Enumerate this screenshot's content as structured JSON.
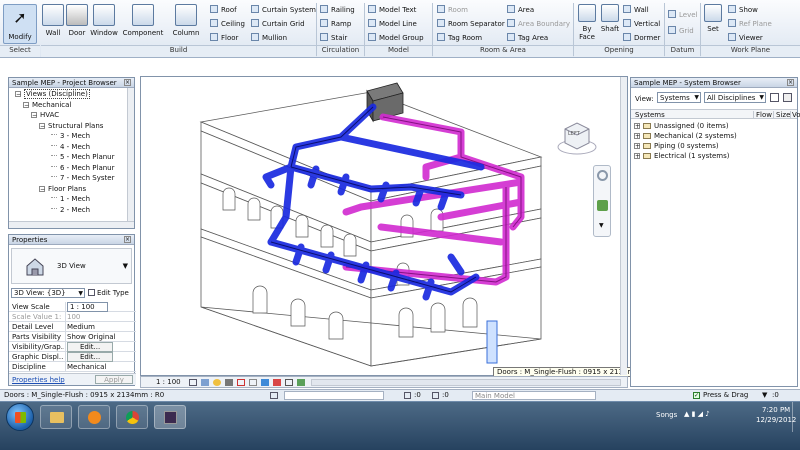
{
  "ribbon": {
    "modify_label": "Modify",
    "wall_label": "Wall",
    "door_label": "Door",
    "window_label": "Window",
    "component_label": "Component",
    "column_label": "Column",
    "roof_label": "Roof",
    "ceiling_label": "Ceiling",
    "floor_label": "Floor",
    "curtain_system_label": "Curtain System",
    "curtain_grid_label": "Curtain Grid",
    "mullion_label": "Mullion",
    "railing_label": "Railing",
    "ramp_label": "Ramp",
    "stair_label": "Stair",
    "model_text_label": "Model Text",
    "model_line_label": "Model Line",
    "model_group_label": "Model Group",
    "room_label": "Room",
    "room_separator_label": "Room Separator",
    "tag_room_label": "Tag Room",
    "area_label": "Area",
    "area_boundary_label": "Area Boundary",
    "tag_area_label": "Tag Area",
    "by_face_label": "By Face",
    "shaft_label": "Shaft",
    "wall_opening_label": "Wall",
    "vertical_label": "Vertical",
    "dormer_label": "Dormer",
    "level_label": "Level",
    "grid_label": "Grid",
    "set_label": "Set",
    "show_label": "Show",
    "ref_plane_label": "Ref Plane",
    "viewer_label": "Viewer",
    "groups": {
      "select": "Select",
      "build": "Build",
      "circulation": "Circulation",
      "model": "Model",
      "room_area": "Room & Area",
      "opening": "Opening",
      "datum": "Datum",
      "work_plane": "Work Plane"
    }
  },
  "project_browser": {
    "title": "Sample MEP - Project Browser",
    "items": [
      {
        "label": "Views (Discipline)",
        "toggle": "−"
      },
      {
        "label": "Mechanical",
        "toggle": "−"
      },
      {
        "label": "HVAC",
        "toggle": "−"
      },
      {
        "label": "Structural Plans",
        "toggle": "−"
      },
      {
        "label": "3 - Mech",
        "toggle": ""
      },
      {
        "label": "4 - Mech",
        "toggle": ""
      },
      {
        "label": "5 - Mech Planur",
        "toggle": ""
      },
      {
        "label": "6 - Mech Planur",
        "toggle": ""
      },
      {
        "label": "7 - Mech Syster",
        "toggle": ""
      },
      {
        "label": "Floor Plans",
        "toggle": "−"
      },
      {
        "label": "1 - Mech",
        "toggle": ""
      },
      {
        "label": "2 - Mech",
        "toggle": ""
      }
    ]
  },
  "properties": {
    "title": "Properties",
    "type_name": "3D View",
    "selector_value": "3D View: {3D}",
    "edit_type_label": "Edit Type",
    "rows": [
      {
        "key": "View Scale",
        "value": "1 : 100"
      },
      {
        "key": "Scale Value    1:",
        "value": "100"
      },
      {
        "key": "Detail Level",
        "value": "Medium"
      },
      {
        "key": "Parts Visibility",
        "value": "Show Original"
      },
      {
        "key": "Visibility/Grap...",
        "value": "Edit..."
      },
      {
        "key": "Graphic Displ...",
        "value": "Edit..."
      },
      {
        "key": "Discipline",
        "value": "Mechanical"
      }
    ],
    "help_label": "Properties help",
    "apply_label": "Apply"
  },
  "system_browser": {
    "title": "Sample MEP - System Browser",
    "view_label": "View:",
    "view_value": "Systems",
    "discipline_value": "All Disciplines",
    "columns": [
      "Systems",
      "Flow",
      "Size",
      "Vo"
    ],
    "items": [
      "Unassigned (0 items)",
      "Mechanical (2 systems)",
      "Piping (0 systems)",
      "Electrical (1 systems)"
    ]
  },
  "viewport": {
    "cube_label": "LEFT",
    "tooltip": "Doors : M_Single-Flush : 0915 x 2134mm : R0",
    "scale": "1 : 100"
  },
  "statusbar": {
    "text": "Doors : M_Single-Flush : 0915 x 2134mm : R0",
    "counter1": ":0",
    "counter2": ":0",
    "model_value": "Main Model",
    "press_drag": "Press & Drag",
    "filter_count": ":0"
  },
  "taskbar": {
    "songs_label": "Songs",
    "time": "7:20 PM",
    "date": "12/29/2012"
  },
  "colors": {
    "supply_duct": "#1a2ae0",
    "return_duct": "#d12ad0",
    "ribbon_bg": "#dde6f1",
    "taskbar_bg": "#26425f"
  }
}
